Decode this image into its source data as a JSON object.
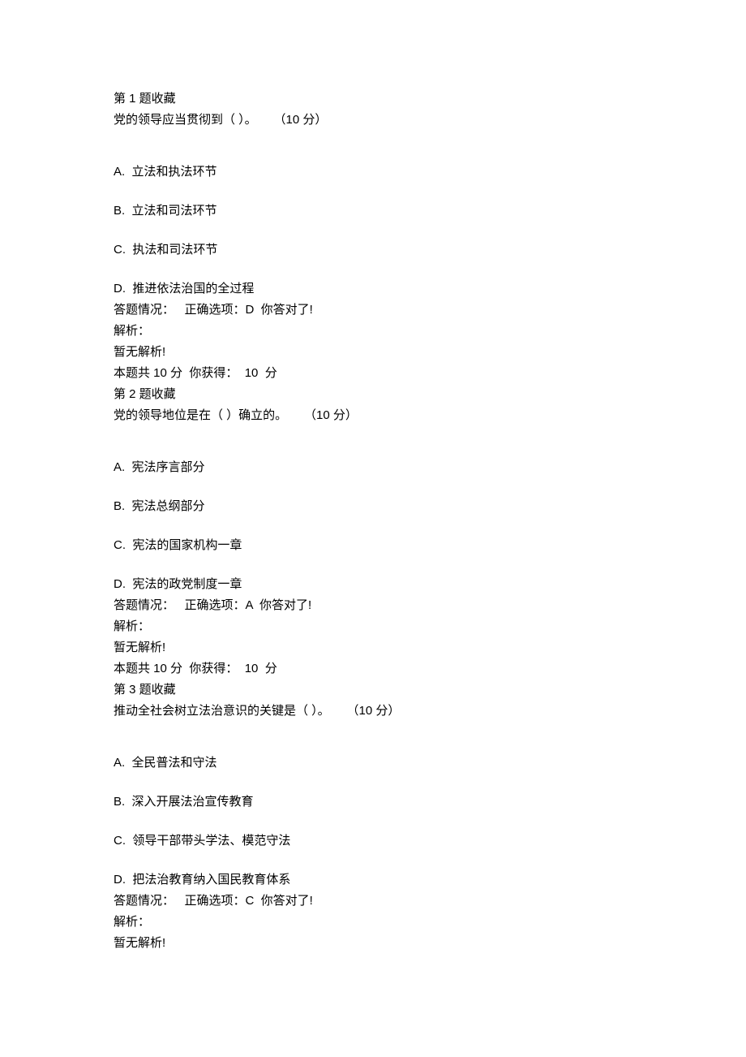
{
  "questions": [
    {
      "header": "第 1 题收藏",
      "stem": "党的领导应当贯彻到（ ）。     （10 分）",
      "options": [
        "A.  立法和执法环节",
        "B.  立法和司法环节",
        "C.  执法和司法环节",
        "D.  推进依法治国的全过程"
      ],
      "result_line": "答题情况：   正确选项：D  你答对了!",
      "explain_label": "解析：",
      "explain_none": "暂无解析!",
      "score_line": "本题共 10 分  你获得：  10  分"
    },
    {
      "header": "第 2 题收藏",
      "stem": "党的领导地位是在（ ）确立的。     （10 分）",
      "options": [
        "A.  宪法序言部分",
        "B.  宪法总纲部分",
        "C.  宪法的国家机构一章",
        "D.  宪法的政党制度一章"
      ],
      "result_line": "答题情况：   正确选项：A  你答对了!",
      "explain_label": "解析：",
      "explain_none": "暂无解析!",
      "score_line": "本题共 10 分  你获得：  10  分"
    },
    {
      "header": "第 3 题收藏",
      "stem": "推动全社会树立法治意识的关键是（ ）。     （10 分）",
      "options": [
        "A.  全民普法和守法",
        "B.  深入开展法治宣传教育",
        "C.  领导干部带头学法、模范守法",
        "D.  把法治教育纳入国民教育体系"
      ],
      "result_line": "答题情况：   正确选项：C  你答对了!",
      "explain_label": "解析：",
      "explain_none": "暂无解析!",
      "score_line": ""
    }
  ]
}
